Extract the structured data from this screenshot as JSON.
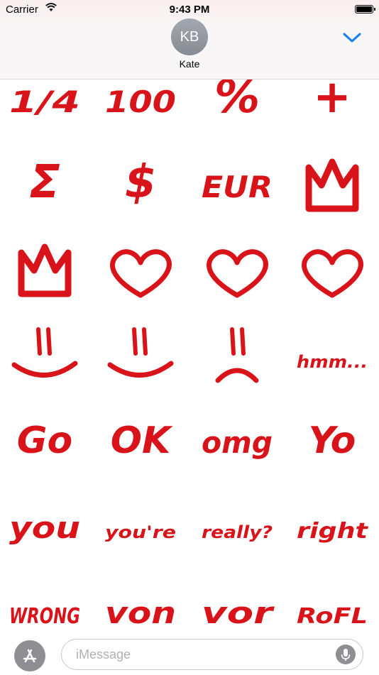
{
  "status": {
    "carrier": "Carrier",
    "time": "9:43 PM"
  },
  "header": {
    "avatar_initials": "KB",
    "contact_name": "Kate"
  },
  "colors": {
    "sticker": "#d8141a",
    "accent": "#1a7cf0"
  },
  "stickers": [
    {
      "text": "1/4"
    },
    {
      "text": "100"
    },
    {
      "text": "%"
    },
    {
      "text": "+"
    },
    {
      "text": "Σ"
    },
    {
      "text": "$"
    },
    {
      "text": "EUR"
    },
    {
      "text": "crown"
    },
    {
      "text": "crown"
    },
    {
      "text": "heart"
    },
    {
      "text": "heart"
    },
    {
      "text": "heart"
    },
    {
      "text": "smile"
    },
    {
      "text": "smile"
    },
    {
      "text": "frown"
    },
    {
      "text": "hmm..."
    },
    {
      "text": "Go"
    },
    {
      "text": "OK"
    },
    {
      "text": "omg"
    },
    {
      "text": "Yo"
    },
    {
      "text": "you"
    },
    {
      "text": "you're"
    },
    {
      "text": "really?"
    },
    {
      "text": "right"
    },
    {
      "text": "WRONG"
    },
    {
      "text": "von"
    },
    {
      "text": "vor"
    },
    {
      "text": "RoFL"
    }
  ],
  "composer": {
    "placeholder": "iMessage"
  }
}
